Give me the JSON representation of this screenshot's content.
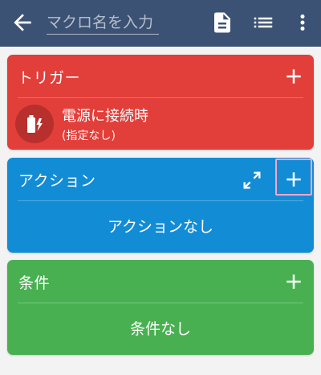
{
  "header": {
    "macro_name_placeholder": "マクロ名を入力",
    "icons": [
      "arrow-left-icon",
      "document-icon",
      "list-icon",
      "more-vert-icon"
    ]
  },
  "trigger": {
    "label": "トリガー",
    "item": {
      "title": "電源に接続時",
      "subtitle": "(指定なし)",
      "icon": "battery-charging-icon"
    },
    "color": "#e23e3a"
  },
  "action": {
    "label": "アクション",
    "empty_text": "アクションなし",
    "color": "#138cd6"
  },
  "condition": {
    "label": "条件",
    "empty_text": "条件なし",
    "color": "#49b052"
  },
  "colors": {
    "appbar": "#3c5274",
    "background": "#f3f3f3",
    "highlight": "#f3a6cc"
  }
}
